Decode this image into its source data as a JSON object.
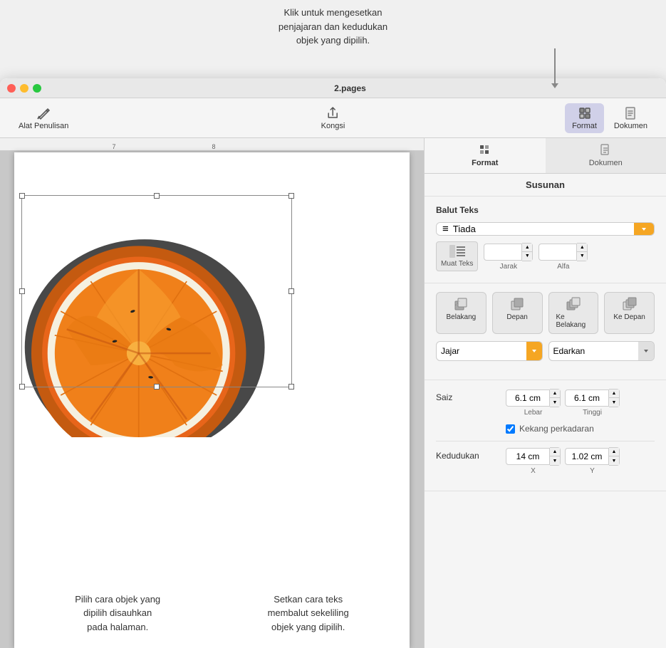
{
  "tooltip": {
    "text": "Klik untuk mengesetkan\npenjajaran dan kedudukan\nobjek yang dipilih."
  },
  "titlebar": {
    "title": "2.pages"
  },
  "toolbar": {
    "left_btn_label": "Alat Penulisan",
    "center_btn_label": "Kongsi",
    "format_btn_label": "Format",
    "dokumen_btn_label": "Dokumen"
  },
  "ruler": {
    "marks": [
      "7",
      "8"
    ]
  },
  "panel": {
    "susunan_label": "Susunan",
    "balut_teks_label": "Balut Teks",
    "tiada_label": "Tiada",
    "muat_teks_label": "Muat Teks",
    "jarak_label": "Jarak",
    "alfa_label": "Alfa",
    "belakang_label": "Belakang",
    "depan_label": "Depan",
    "ke_belakang_label": "Ke Belakang",
    "ke_depan_label": "Ke Depan",
    "jajar_label": "Jajar",
    "edarkan_label": "Edarkan",
    "saiz_label": "Saiz",
    "lebar_label": "Lebar",
    "tinggi_label": "Tinggi",
    "lebar_value": "6.1 cm",
    "tinggi_value": "6.1 cm",
    "kekang_label": "Kekang perkadaran",
    "kedudukan_label": "Kedudukan",
    "x_label": "X",
    "y_label": "Y",
    "x_value": "14 cm",
    "y_value": "1.02 cm"
  },
  "annotations": {
    "bottom_left": "Pilih cara objek yang\ndipilih disauhkan\npada halaman.",
    "bottom_right": "Setkan cara teks\nmembalut sekeliling\nobjek yang dipilih."
  }
}
